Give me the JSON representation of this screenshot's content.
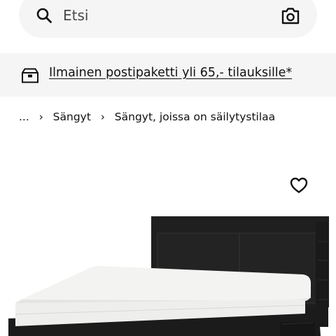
{
  "search": {
    "placeholder": "Etsi"
  },
  "icons": {
    "search": "search-icon",
    "camera": "camera-icon",
    "delivery": "delivery-box-icon",
    "favourite": "heart-icon",
    "breadcrumb_separator": "chevron-right-icon"
  },
  "promo": {
    "text": "Ilmainen postipaketti yli 65,- tilauksille*"
  },
  "breadcrumb": {
    "items": [
      {
        "label": "..."
      },
      {
        "label": "Sängyt"
      },
      {
        "label": "Sängyt, joissa on säilytystilaa"
      }
    ],
    "separator": "›"
  },
  "product": {
    "colors": {
      "frame": "#1e1e1e",
      "mattress": "#f2f2f0",
      "background": "#ffffff"
    }
  }
}
